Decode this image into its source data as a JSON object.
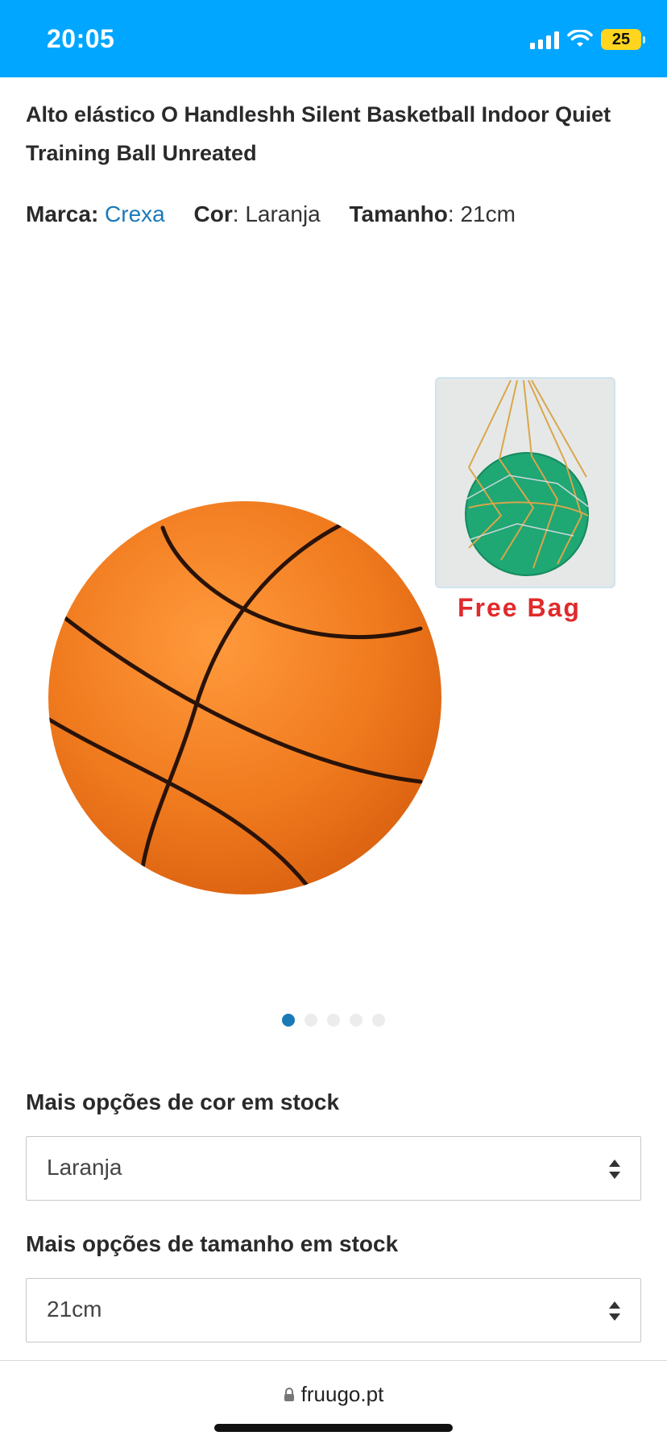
{
  "status_bar": {
    "time": "20:05",
    "battery": "25",
    "background": "#00a6ff"
  },
  "product": {
    "title": "Alto elástico O Handleshh Silent Basketball Indoor Quiet Training Ball Unreated",
    "brand_label": "Marca:",
    "brand_value": "Crexa",
    "color_label": "Cor",
    "color_sep": ":",
    "color_value": "Laranja",
    "size_label": "Tamanho",
    "size_sep": ":",
    "size_value": "21cm"
  },
  "gallery": {
    "main_image": "orange basketball",
    "inset_image": "green ball in net bag",
    "inset_label": "Free Bag",
    "dot_count": 5,
    "active_dot": 1
  },
  "options": {
    "color_heading": "Mais opções de cor em stock",
    "color_selected": "Laranja",
    "size_heading": "Mais opções de tamanho em stock",
    "size_selected": "21cm"
  },
  "browser": {
    "url": "fruugo.pt",
    "lock_icon": "lock-icon"
  },
  "colors": {
    "accent": "#1a7ab8",
    "bag_label": "#e02a2a",
    "ball": "#f07a1e"
  }
}
